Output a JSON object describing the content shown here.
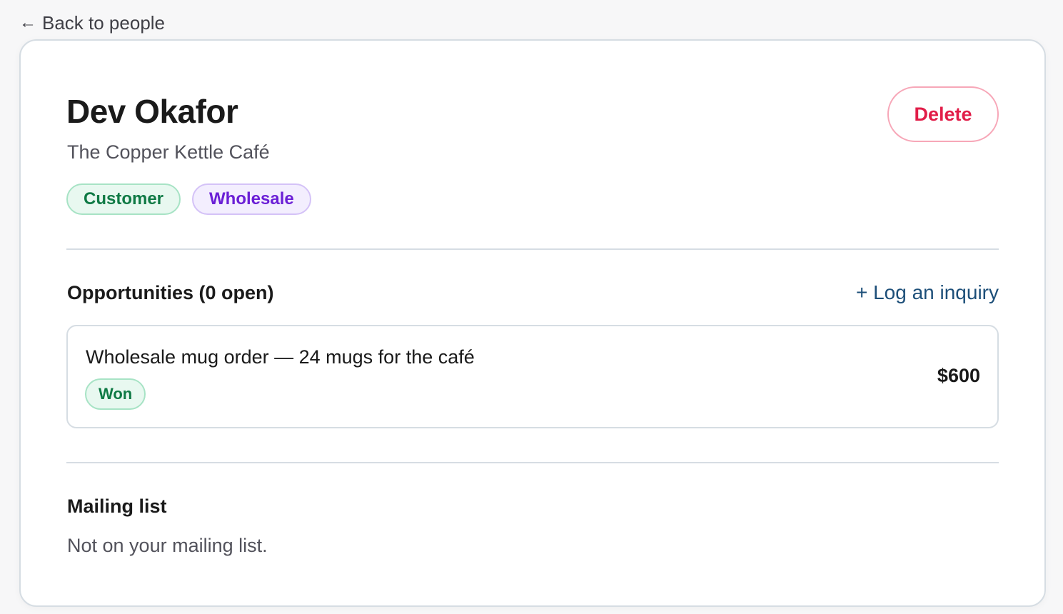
{
  "nav": {
    "back_label": "Back to people",
    "back_icon": "arrow-left-icon"
  },
  "person": {
    "name": "Dev Okafor",
    "company": "The Copper Kettle Café",
    "tags": [
      "Customer",
      "Wholesale"
    ]
  },
  "actions": {
    "delete_label": "Delete"
  },
  "opportunities": {
    "title": "Opportunities (0 open)",
    "log_link": "+ Log an inquiry",
    "items": [
      {
        "name": "Wholesale mug order — 24 mugs for the café",
        "status": "Won",
        "amount": "$600"
      }
    ]
  },
  "mailing": {
    "title": "Mailing list",
    "status_text": "Not on your mailing list."
  },
  "colors": {
    "delete_text": "#e11d48",
    "customer_tag": "#0f7a45",
    "wholesale_tag": "#6b1fd6",
    "link": "#1d4f79"
  }
}
